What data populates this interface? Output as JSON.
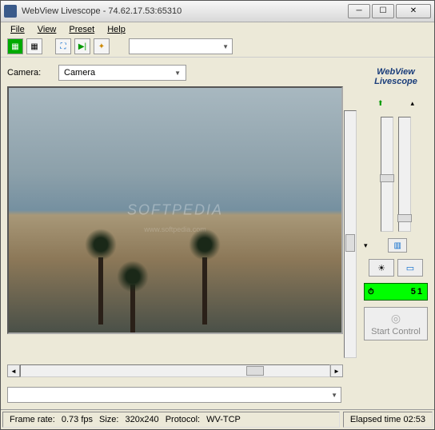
{
  "titlebar": {
    "title": "WebView Livescope - 74.62.17.53:65310"
  },
  "menubar": {
    "file": "File",
    "view": "View",
    "preset": "Preset",
    "help": "Help"
  },
  "toolbar": {
    "combo_value": ""
  },
  "camera": {
    "label": "Camera:",
    "selected": "Camera"
  },
  "logo": {
    "line1": "WebView",
    "line2": "Livescope"
  },
  "watermark": {
    "main": "SOFTPEDIA",
    "sub": "www.softpedia.com"
  },
  "timer": {
    "value": "51"
  },
  "start_control": {
    "label": "Start Control"
  },
  "statusbar": {
    "frame_rate_label": "Frame rate:",
    "frame_rate_value": "0.73 fps",
    "size_label": "Size:",
    "size_value": "320x240",
    "protocol_label": "Protocol:",
    "protocol_value": "WV-TCP",
    "elapsed_label": "Elapsed time",
    "elapsed_value": "02:53"
  }
}
